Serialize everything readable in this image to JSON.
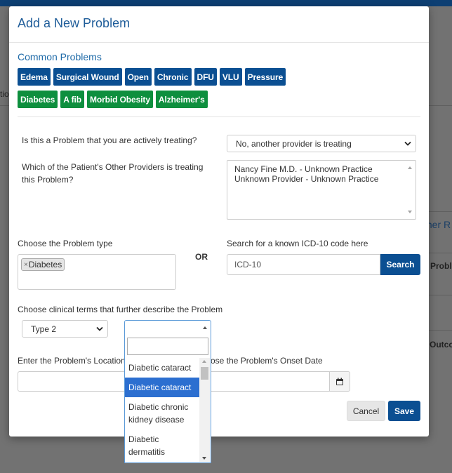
{
  "background": {
    "fragments": [
      "tio",
      "ther R",
      "Proble",
      "Outco"
    ]
  },
  "modal": {
    "title": "Add a New Problem",
    "common_problems_title": "Common Problems",
    "common_row1": [
      "Edema",
      "Surgical Wound",
      "Open",
      "Chronic",
      "DFU",
      "VLU",
      "Pressure"
    ],
    "common_row2": [
      "Diabetes",
      "A fib",
      "Morbid Obesity",
      "Alzheimer's"
    ],
    "actively_treating": {
      "label": "Is this a Problem that you are actively treating?",
      "value": "No, another provider is treating"
    },
    "other_providers": {
      "label": "Which of the Patient's Other Providers is treating this Problem?",
      "options": [
        "Nancy Fine M.D. - Unknown Practice",
        "Unknown Provider - Unknown Practice"
      ]
    },
    "problem_type": {
      "label": "Choose the Problem type",
      "tag": "Diabetes",
      "tag_remove": "×"
    },
    "or_label": "OR",
    "icd": {
      "label": "Search for a known ICD-10 code here",
      "placeholder": "ICD-10",
      "button": "Search"
    },
    "clinical_terms": {
      "label": "Choose clinical terms that further describe the Problem",
      "type_value": "Type 2"
    },
    "location_label": "Enter the Problem's Location",
    "onset_label": "ose the Problem's Onset Date",
    "cancel": "Cancel",
    "save": "Save"
  },
  "dropdown": {
    "options": [
      "Diabetic cataract",
      "Diabetic cataract",
      "Diabetic chronic kidney disease",
      "Diabetic dermatitis"
    ],
    "highlighted_index": 1
  }
}
